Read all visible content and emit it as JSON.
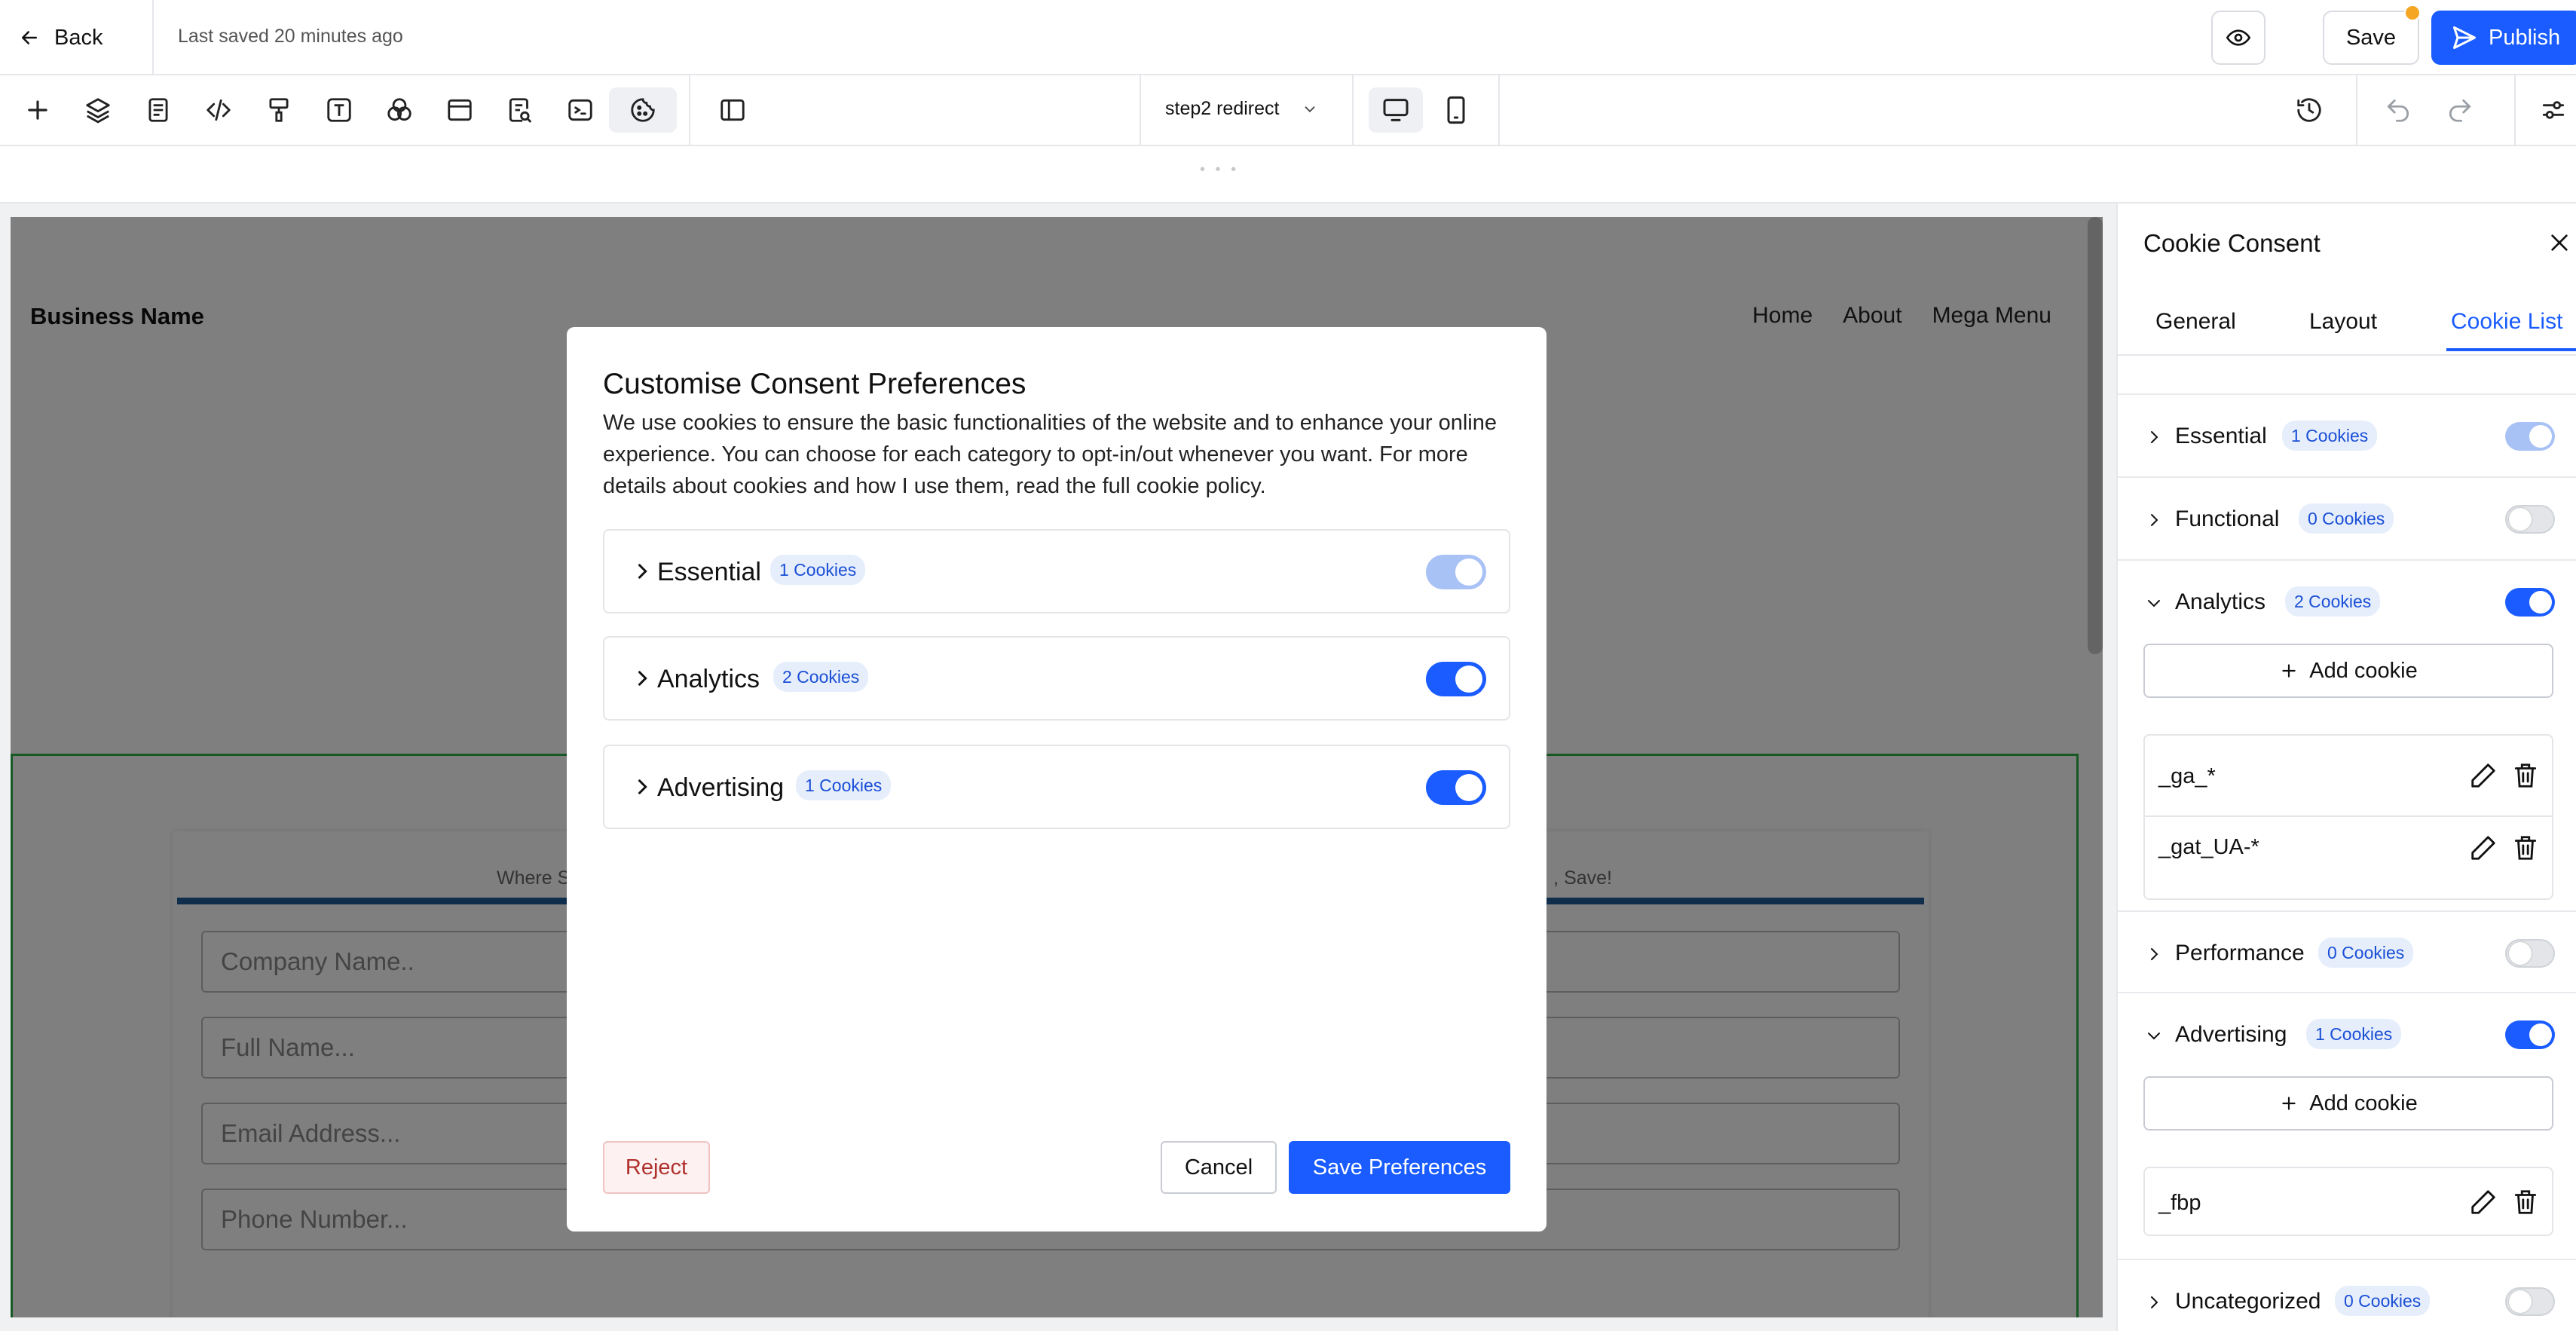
{
  "topbar": {
    "back_label": "Back",
    "last_saved": "Last saved 20 minutes ago",
    "save_label": "Save",
    "publish_label": "Publish"
  },
  "toolbar": {
    "page_select": "step2 redirect"
  },
  "site": {
    "business_name": "Business Name",
    "nav": [
      "Home",
      "About",
      "Mega Menu"
    ],
    "tagline_left": "Where S",
    "tagline_right": ", Save!",
    "fields": [
      "Company Name..",
      "Full Name...",
      "Email Address...",
      "Phone Number..."
    ]
  },
  "modal": {
    "title": "Customise Consent Preferences",
    "description": "We use cookies to ensure the basic functionalities of the website and to enhance your online experience. You can choose for each category to opt-in/out whenever you want. For more details about cookies and how I use them, read the full cookie policy.",
    "categories": [
      {
        "name": "Essential",
        "count": "1 Cookies",
        "state": "disabled-on"
      },
      {
        "name": "Analytics",
        "count": "2 Cookies",
        "state": "on"
      },
      {
        "name": "Advertising",
        "count": "1 Cookies",
        "state": "on"
      }
    ],
    "reject_label": "Reject",
    "cancel_label": "Cancel",
    "save_label": "Save Preferences"
  },
  "panel": {
    "title": "Cookie Consent",
    "tabs": [
      "General",
      "Layout",
      "Cookie List"
    ],
    "active_tab": "Cookie List",
    "rows": [
      {
        "name": "Essential",
        "count": "1 Cookies",
        "state": "disabled-on",
        "expanded": false
      },
      {
        "name": "Functional",
        "count": "0 Cookies",
        "state": "off",
        "expanded": false
      },
      {
        "name": "Analytics",
        "count": "2 Cookies",
        "state": "on",
        "expanded": true
      },
      {
        "name": "Performance",
        "count": "0 Cookies",
        "state": "off",
        "expanded": false
      },
      {
        "name": "Advertising",
        "count": "1 Cookies",
        "state": "on",
        "expanded": true
      },
      {
        "name": "Uncategorized",
        "count": "0 Cookies",
        "state": "off",
        "expanded": false
      }
    ],
    "add_cookie_label": "Add cookie",
    "analytics_cookies": [
      "_ga_*",
      "_gat_UA-*"
    ],
    "advertising_cookies": [
      "_fbp"
    ]
  },
  "colors": {
    "accent": "#1a5cff",
    "badge_bg": "#e6eefc",
    "reject_text": "#b0302c",
    "green_outline": "#2db34a",
    "form_bar": "#1f5c99",
    "unsaved_dot": "#f5a623"
  }
}
